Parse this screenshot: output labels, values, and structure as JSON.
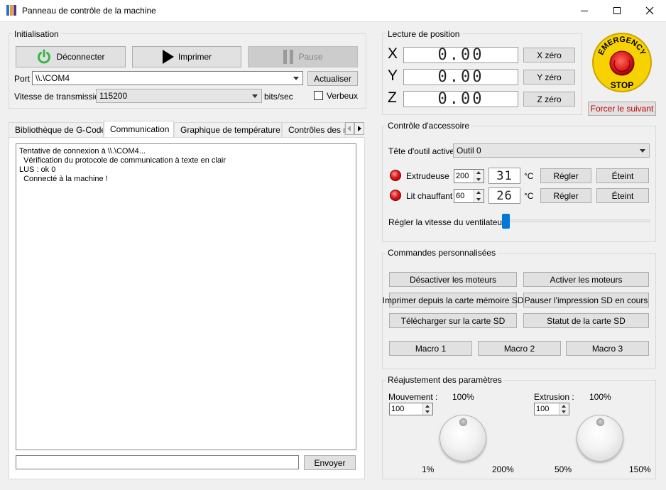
{
  "window": {
    "title": "Panneau de contrôle de la machine",
    "minimize_glyph": "—",
    "maximize_glyph": "☐",
    "close_glyph": "✕"
  },
  "colors": {
    "accent_green": "#39b54a",
    "emergency_red": "#d7191c",
    "emergency_yellow": "#f7d200",
    "force_text": "#c00000"
  },
  "initialisation": {
    "title": "Initialisation",
    "connect_label": "Déconnecter",
    "print_label": "Imprimer",
    "pause_label": "Pause",
    "port_label": "Port",
    "port_value": "\\\\.\\COM4",
    "refresh_label": "Actualiser",
    "baud_label": "Vitesse de transmission",
    "baud_value": "115200",
    "baud_unit": "bits/sec",
    "verbose_label": "Verbeux"
  },
  "tabs": [
    {
      "label": "Bibliothèque de G-Code"
    },
    {
      "label": "Communication"
    },
    {
      "label": "Graphique de température"
    },
    {
      "label": "Contrôles des moteurs"
    }
  ],
  "communication": {
    "lines": [
      "Tentative de connexion à \\\\.\\COM4...",
      "  Vérification du protocole de communication à texte en clair",
      "LUS : ok 0",
      "  Connecté à la machine !"
    ],
    "input_value": "",
    "send_label": "Envoyer"
  },
  "position": {
    "title": "Lecture de position",
    "axes": [
      {
        "axis": "X",
        "value": "0.00",
        "zero_label": "X zéro"
      },
      {
        "axis": "Y",
        "value": "0.00",
        "zero_label": "Y zéro"
      },
      {
        "axis": "Z",
        "value": "0.00",
        "zero_label": "Z zéro"
      }
    ]
  },
  "emergency": {
    "top_text": "EMERGENCY",
    "bottom_text": "STOP",
    "force_label": "Forcer le suivant"
  },
  "accessory": {
    "title": "Contrôle d'accessoire",
    "tool_label": "Tête d'outil active",
    "tool_value": "Outil 0",
    "extruder_label": "Extrudeuse",
    "extruder_set": "200",
    "extruder_temp": "31",
    "bed_label": "Lit chauffant",
    "bed_set": "60",
    "bed_temp": "26",
    "unit": "°C",
    "set_label": "Régler",
    "off_label": "Éteint",
    "fan_label": "Régler la vitesse du ventilateur",
    "fan_level": 0
  },
  "custom": {
    "title": "Commandes personnalisées",
    "buttons": [
      "Désactiver les moteurs",
      "Activer les moteurs",
      "Imprimer depuis la carte mémoire SD",
      "Pauser l'impression SD en cours",
      "Télécharger sur la carte SD",
      "Statut de la carte SD"
    ],
    "macros": [
      "Macro 1",
      "Macro 2",
      "Macro 3"
    ]
  },
  "tuning": {
    "title": "Réajustement des paramètres",
    "movement_label": "Mouvement :",
    "movement_value": "100",
    "movement_top": "100%",
    "movement_min": "1%",
    "movement_max": "200%",
    "extrusion_label": "Extrusion :",
    "extrusion_value": "100",
    "extrusion_top": "100%",
    "extrusion_min": "50%",
    "extrusion_max": "150%"
  }
}
